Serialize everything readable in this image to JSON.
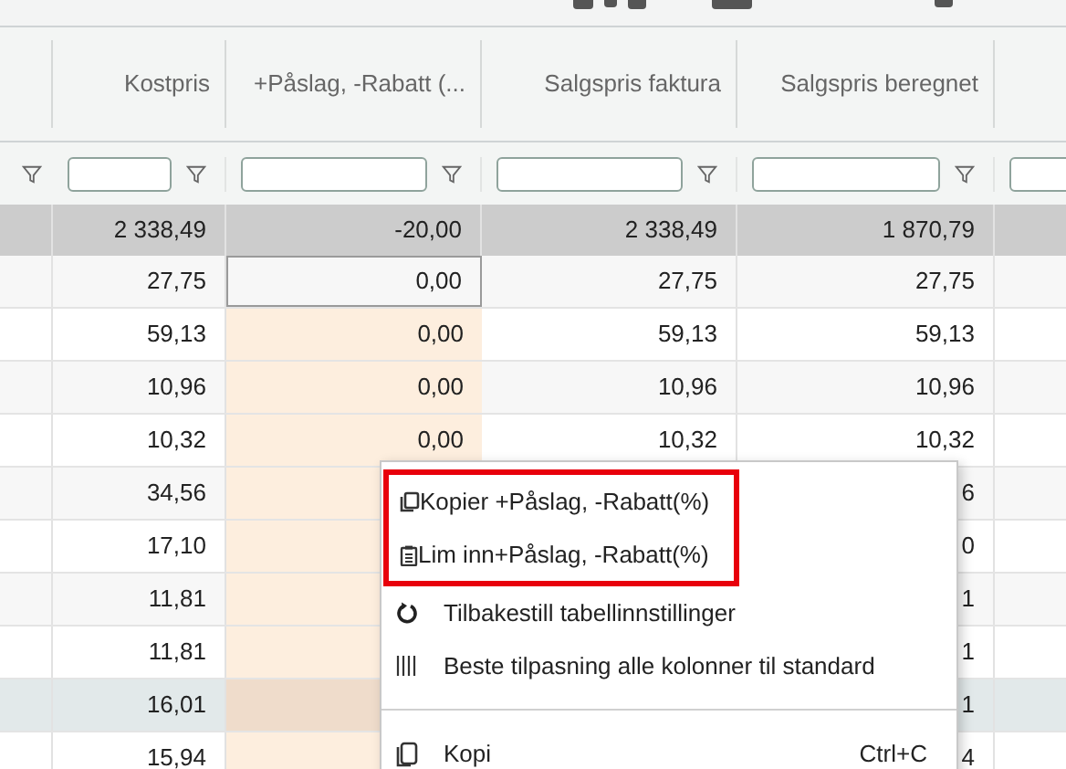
{
  "table": {
    "columns": [
      "Kostpris",
      "+Påslag, -Rabatt (...",
      "Salgspris faktura",
      "Salgspris beregnet"
    ],
    "total_row": [
      "2 338,49",
      "-20,00",
      "2 338,49",
      "1 870,79"
    ],
    "rows": [
      {
        "kostpris": "27,75",
        "paslag": "0,00",
        "faktura": "27,75",
        "beregnet": "27,75",
        "selected": false,
        "focused": true
      },
      {
        "kostpris": "59,13",
        "paslag": "0,00",
        "faktura": "59,13",
        "beregnet": "59,13",
        "selected": false,
        "focused": false
      },
      {
        "kostpris": "10,96",
        "paslag": "0,00",
        "faktura": "10,96",
        "beregnet": "10,96",
        "selected": false,
        "focused": false
      },
      {
        "kostpris": "10,32",
        "paslag": "0,00",
        "faktura": "10,32",
        "beregnet": "10,32",
        "selected": false,
        "focused": false
      },
      {
        "kostpris": "34,56",
        "beregnet": "6",
        "selected": false,
        "focused": false
      },
      {
        "kostpris": "17,10",
        "beregnet": "0",
        "selected": false,
        "focused": false
      },
      {
        "kostpris": "11,81",
        "beregnet": "1",
        "selected": false,
        "focused": false
      },
      {
        "kostpris": "11,81",
        "beregnet": "1",
        "selected": false,
        "focused": false
      },
      {
        "kostpris": "16,01",
        "beregnet": "1",
        "selected": true,
        "focused": false
      },
      {
        "kostpris": "15,94",
        "beregnet": "4",
        "selected": false,
        "focused": false
      }
    ]
  },
  "context_menu": {
    "items": [
      {
        "kind": "item",
        "label": "Kopier +Påslag, -Rabatt(%)",
        "highlighted": true
      },
      {
        "kind": "item",
        "label": "Lim inn+Påslag, -Rabatt(%)",
        "highlighted": true
      },
      {
        "kind": "item",
        "label": "Tilbakestill tabellinnstillinger",
        "highlighted": false
      },
      {
        "kind": "item",
        "label": "Beste tilpasning alle kolonner til standard",
        "highlighted": false
      },
      {
        "kind": "divider"
      },
      {
        "kind": "item",
        "label": "Kopi",
        "shortcut": "Ctrl+C",
        "highlighted": false
      }
    ]
  }
}
